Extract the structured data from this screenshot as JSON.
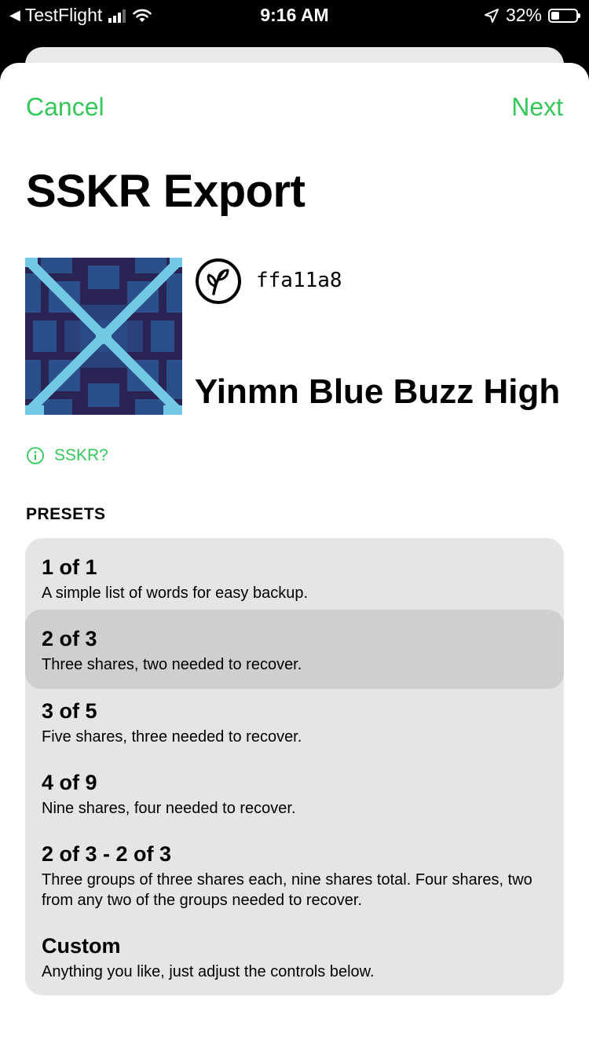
{
  "status_bar": {
    "app": "TestFlight",
    "time": "9:16 AM",
    "battery": "32%"
  },
  "nav": {
    "cancel": "Cancel",
    "next": "Next"
  },
  "title": "SSKR Export",
  "seed": {
    "id": "ffa11a8",
    "name": "Yinmn Blue Buzz High"
  },
  "info_link": "SSKR?",
  "presets_header": "PRESETS",
  "presets": [
    {
      "title": "1 of 1",
      "desc": "A simple list of words for easy backup."
    },
    {
      "title": "2 of 3",
      "desc": "Three shares, two needed to recover."
    },
    {
      "title": "3 of 5",
      "desc": "Five shares, three needed to recover."
    },
    {
      "title": "4 of 9",
      "desc": "Nine shares, four needed to recover."
    },
    {
      "title": "2 of 3 - 2 of 3",
      "desc": "Three groups of three shares each, nine shares total. Four shares, two from any two of the groups needed to recover."
    },
    {
      "title": "Custom",
      "desc": "Anything you like, just adjust the controls below."
    }
  ],
  "colors": {
    "accent": "#34c759",
    "lifehash_dark": "#2a2455",
    "lifehash_mid": "#2b4f8a",
    "lifehash_light": "#72c9e4"
  }
}
